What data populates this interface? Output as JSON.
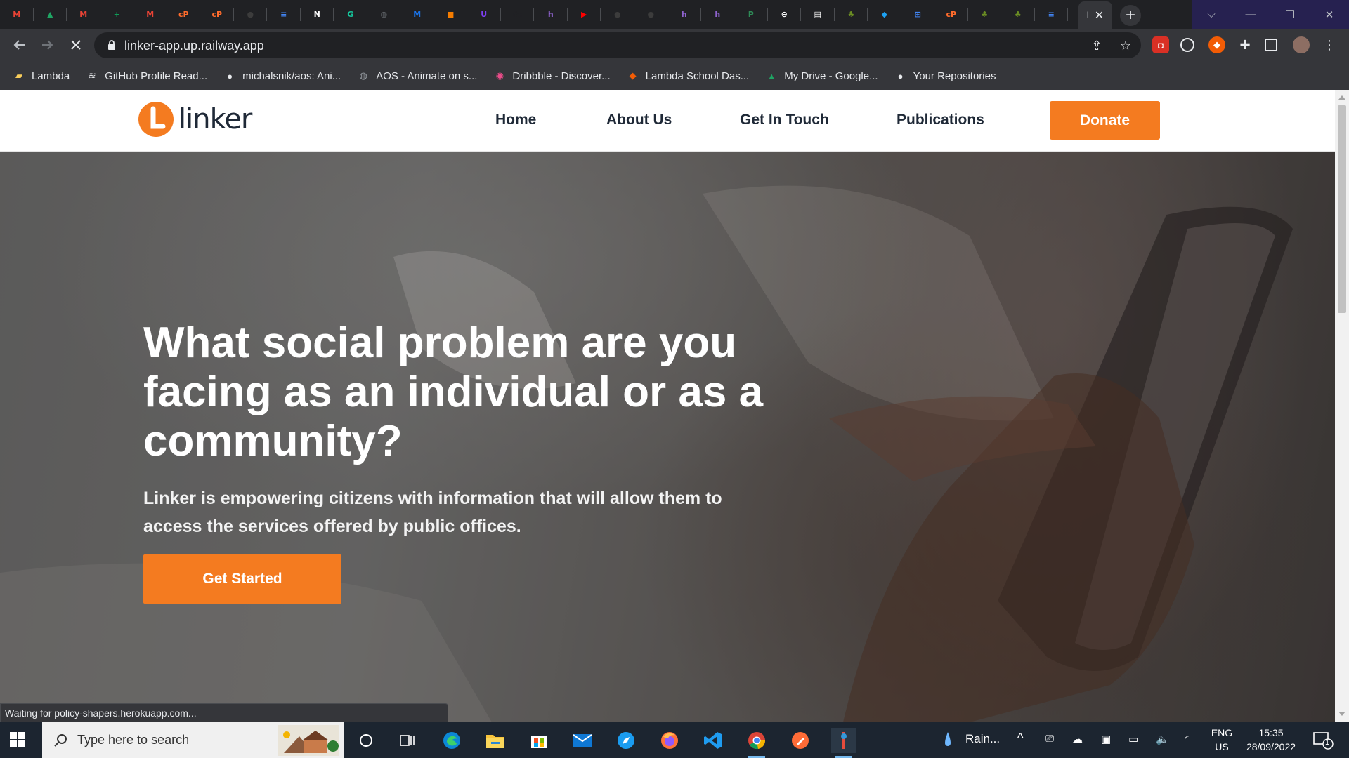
{
  "browser": {
    "tabs": [
      {
        "icon": "gmail-icon",
        "color": "#ea4335",
        "glyph": "M"
      },
      {
        "icon": "google-drive-icon",
        "color": "#1fa463",
        "glyph": "▲"
      },
      {
        "icon": "gmail-icon",
        "color": "#ea4335",
        "glyph": "M"
      },
      {
        "icon": "google-sheets-icon",
        "color": "#0f9d58",
        "glyph": "+"
      },
      {
        "icon": "gmail-icon",
        "color": "#ea4335",
        "glyph": "M"
      },
      {
        "icon": "cpanel-icon",
        "color": "#ff6c2c",
        "glyph": "cP"
      },
      {
        "icon": "cpanel-icon",
        "color": "#ff6c2c",
        "glyph": "cP"
      },
      {
        "icon": "github-icon",
        "color": "#3c3c3c",
        "glyph": "●"
      },
      {
        "icon": "google-docs-icon",
        "color": "#4285f4",
        "glyph": "≡"
      },
      {
        "icon": "notion-icon",
        "color": "#ffffff",
        "glyph": "N"
      },
      {
        "icon": "grammarly-icon",
        "color": "#15c39a",
        "glyph": "G"
      },
      {
        "icon": "globe-icon",
        "color": "#5f6368",
        "glyph": "◍"
      },
      {
        "icon": "code-icon",
        "color": "#1a73e8",
        "glyph": "M"
      },
      {
        "icon": "box-icon",
        "color": "#f57c00",
        "glyph": "■"
      },
      {
        "icon": "purple-u-icon",
        "color": "#7e3ff2",
        "glyph": "U"
      },
      {
        "icon": "ampersand-icon",
        "color": "#202124",
        "glyph": "&;"
      },
      {
        "icon": "hashnode-icon",
        "color": "#8e63ce",
        "glyph": "h"
      },
      {
        "icon": "youtube-icon",
        "color": "#ff0000",
        "glyph": "▶"
      },
      {
        "icon": "github-icon",
        "color": "#3c3c3c",
        "glyph": "●"
      },
      {
        "icon": "github-icon",
        "color": "#3c3c3c",
        "glyph": "●"
      },
      {
        "icon": "hashnode-icon",
        "color": "#8e63ce",
        "glyph": "h"
      },
      {
        "icon": "hashnode-icon",
        "color": "#8e63ce",
        "glyph": "h"
      },
      {
        "icon": "pdf-icon",
        "color": "#2e8b57",
        "glyph": "P"
      },
      {
        "icon": "circle-icon",
        "color": "#ffffff",
        "glyph": "⊝"
      },
      {
        "icon": "notes-icon",
        "color": "#ffffff",
        "glyph": "▤"
      },
      {
        "icon": "campaign-icon",
        "color": "#6b8e23",
        "glyph": "♣"
      },
      {
        "icon": "shield-icon",
        "color": "#1da1f2",
        "glyph": "◆"
      },
      {
        "icon": "grid-icon",
        "color": "#4285f4",
        "glyph": "⊞"
      },
      {
        "icon": "cpanel-icon",
        "color": "#ff6c2c",
        "glyph": "cP"
      },
      {
        "icon": "campaign-icon",
        "color": "#6b8e23",
        "glyph": "♣"
      },
      {
        "icon": "campaign-icon",
        "color": "#6b8e23",
        "glyph": "♣"
      },
      {
        "icon": "google-docs-icon",
        "color": "#4285f4",
        "glyph": "≡"
      }
    ],
    "active_tab_text": "l",
    "url": "linker-app.up.railway.app",
    "bookmarks": [
      {
        "icon": "folder-icon",
        "label": "Lambda"
      },
      {
        "icon": "mdg-icon",
        "label": "GitHub Profile Read..."
      },
      {
        "icon": "github-icon",
        "label": "michalsnik/aos: Ani..."
      },
      {
        "icon": "aos-icon",
        "label": "AOS - Animate on s..."
      },
      {
        "icon": "dribbble-icon",
        "label": "Dribbble - Discover..."
      },
      {
        "icon": "lambda-icon",
        "label": "Lambda School Das..."
      },
      {
        "icon": "google-drive-icon",
        "label": "My Drive - Google..."
      },
      {
        "icon": "github-icon",
        "label": "Your Repositories"
      }
    ],
    "status": "Waiting for policy-shapers.herokuapp.com..."
  },
  "site": {
    "logo_text": "linker",
    "nav": [
      "Home",
      "About Us",
      "Get In Touch",
      "Publications"
    ],
    "donate": "Donate",
    "hero": {
      "title": "What social problem are you facing as an individual or as a community?",
      "subtitle": "Linker is empowering citizens with information that will allow them to access the services offered by public offices.",
      "cta": "Get Started"
    },
    "accent_color": "#f47b20"
  },
  "taskbar": {
    "search_placeholder": "Type here to search",
    "weather": "Rain...",
    "lang_line1": "ENG",
    "lang_line2": "US",
    "time": "15:35",
    "date": "28/09/2022",
    "notifications": "1"
  }
}
